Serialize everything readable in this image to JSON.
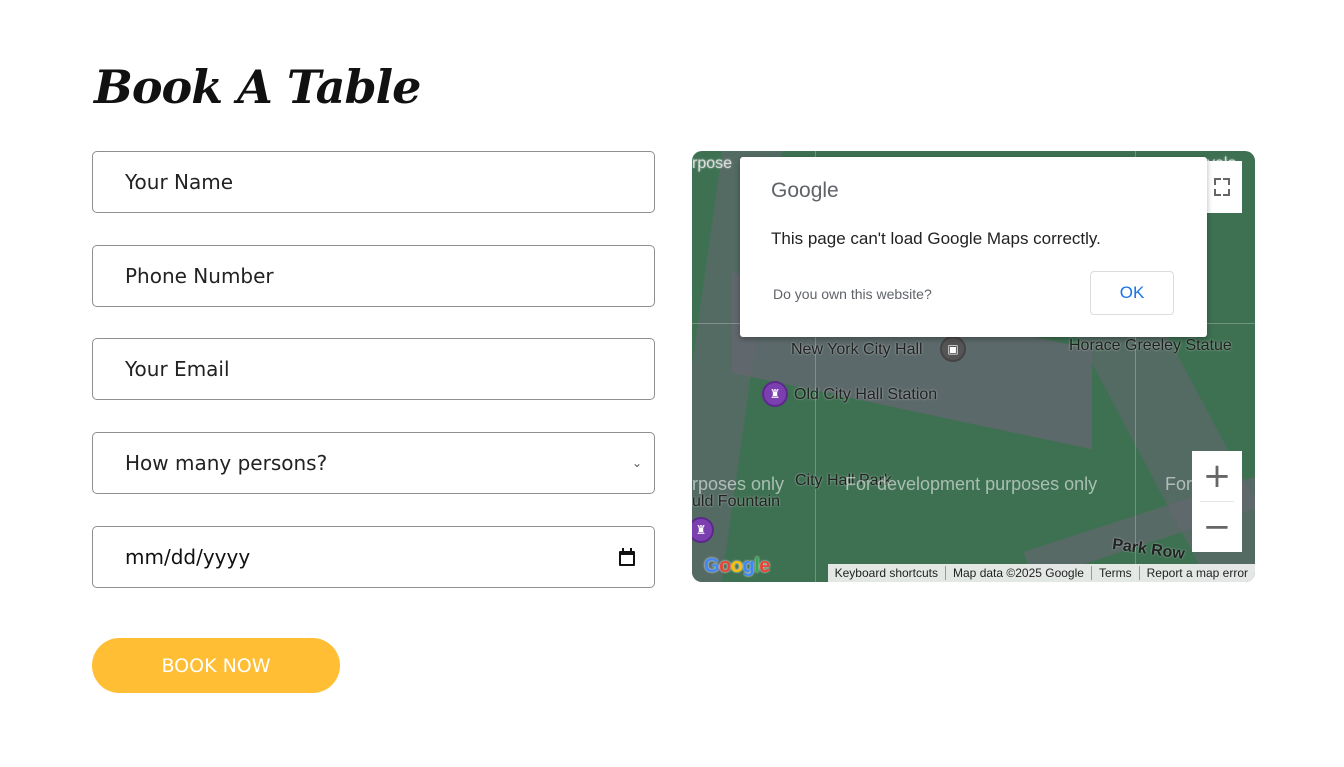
{
  "heading": "Book A Table",
  "form": {
    "name_placeholder": "Your Name",
    "phone_placeholder": "Phone Number",
    "email_placeholder": "Your Email",
    "persons_selected": "How many persons?",
    "date_value": "mm/dd/yyyy",
    "submit_label": "BOOK NOW"
  },
  "map": {
    "dialog": {
      "logo": "Google",
      "message": "This page can't load Google Maps correctly.",
      "own_link": "Do you own this website?",
      "ok_label": "OK"
    },
    "labels": {
      "city_hall": "New York City Hall",
      "station": "Old City Hall Station",
      "statue": "Horace Greeley Statue",
      "park": "City Hall Park",
      "fountain": "uld Fountain",
      "row": "Park Row",
      "top_left": "rpose",
      "top_right": "velo"
    },
    "dev_watermark": "For development purposes only",
    "dev_watermark_left": "rposes only",
    "dev_watermark_right": "For d",
    "zoom_in": "+",
    "zoom_out": "−",
    "logo": "Google",
    "attribution": [
      "Keyboard shortcuts",
      "Map data ©2025 Google",
      "Terms",
      "Report a map error"
    ]
  },
  "colors": {
    "accent": "#ffbe33",
    "map_green": "#3f7a55",
    "link_blue": "#1a73e8"
  }
}
